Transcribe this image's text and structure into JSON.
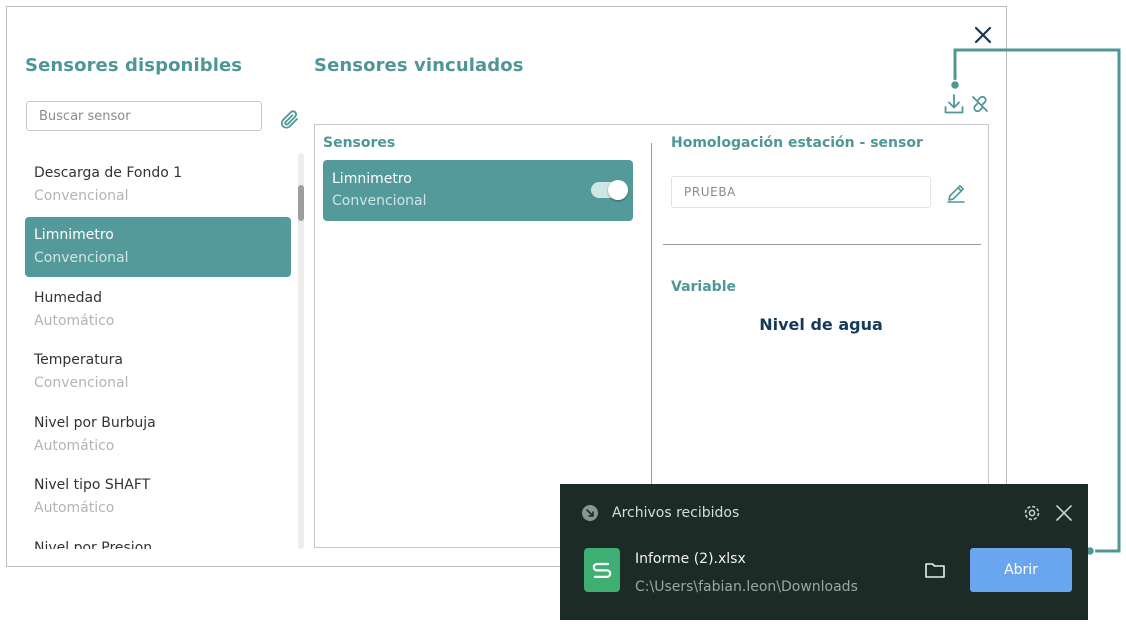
{
  "modal": {
    "left_title": "Sensores disponibles",
    "right_title": "Sensores vinculados"
  },
  "search": {
    "placeholder": "Buscar sensor"
  },
  "available_sensors": [
    {
      "name": "Descarga de Fondo 1",
      "type": "Convencional",
      "selected": false
    },
    {
      "name": "Limnimetro",
      "type": "Convencional",
      "selected": true
    },
    {
      "name": "Humedad",
      "type": "Automático",
      "selected": false
    },
    {
      "name": "Temperatura",
      "type": "Convencional",
      "selected": false
    },
    {
      "name": "Nivel por Burbuja",
      "type": "Automático",
      "selected": false
    },
    {
      "name": "Nivel tipo SHAFT",
      "type": "Automático",
      "selected": false
    },
    {
      "name": "Nivel por Presion",
      "type": "",
      "selected": false
    }
  ],
  "linked": {
    "sensors_header": "Sensores",
    "card": {
      "name": "Limnimetro",
      "type": "Convencional",
      "toggle_on": true
    },
    "homologation_header": "Homologación estación - sensor",
    "homologation_value": "PRUEBA",
    "variable_header": "Variable",
    "variable_value": "Nivel de agua"
  },
  "toast": {
    "title": "Archivos recibidos",
    "file_name": "Informe (2).xlsx",
    "file_path": "C:\\Users\\fabian.leon\\Downloads",
    "open_label": "Abrir"
  },
  "colors": {
    "accent": "#559a9a",
    "title": "#4f9797",
    "variable_text": "#143a5a",
    "toast_bg": "#1d2b27",
    "open_button": "#6aa6ef",
    "file_icon": "#3fae72",
    "connector": "#4f9797"
  },
  "icons": {
    "close": "close-icon",
    "attach": "paperclip-icon",
    "download": "download-icon",
    "unlink": "unlink-icon",
    "edit": "pencil-icon",
    "settings": "gear-icon",
    "folder": "folder-icon",
    "spreadsheet": "spreadsheet-file-icon"
  }
}
